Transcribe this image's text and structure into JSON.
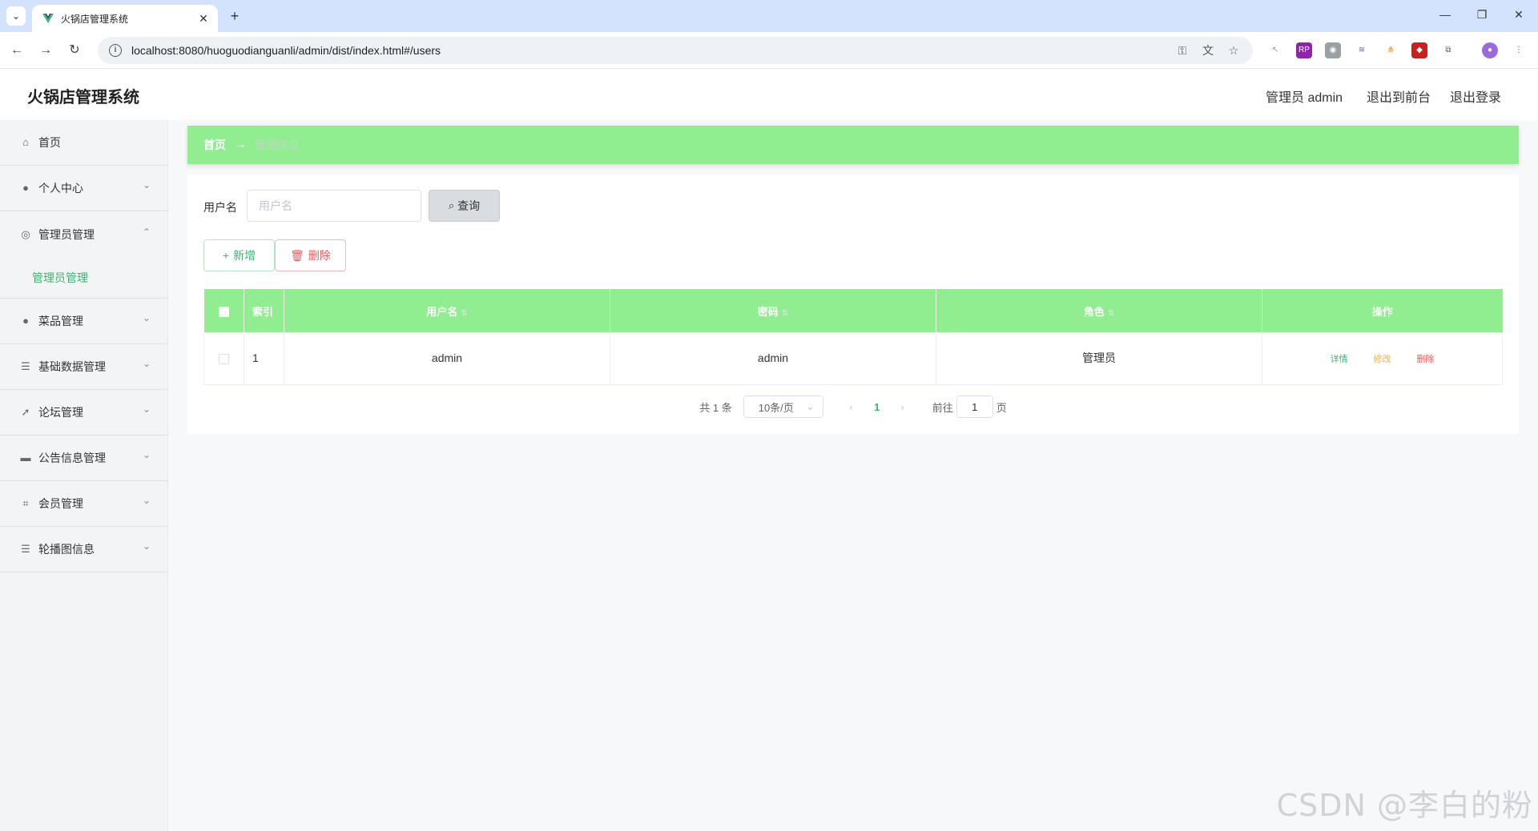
{
  "browser": {
    "tab_title": "火锅店管理系统",
    "url": "localhost:8080/huoguodianguanli/admin/dist/index.html#/users"
  },
  "header": {
    "app_title": "火锅店管理系统",
    "user_label": "管理员 admin",
    "front_link": "退出到前台",
    "logout_link": "退出登录"
  },
  "sidebar": {
    "items": [
      {
        "label": "首页",
        "icon": "home-icon"
      },
      {
        "label": "个人中心",
        "icon": "user-icon"
      },
      {
        "label": "管理员管理",
        "icon": "compass-icon"
      },
      {
        "label": "菜品管理",
        "icon": "user-icon"
      },
      {
        "label": "基础数据管理",
        "icon": "list-icon"
      },
      {
        "label": "论坛管理",
        "icon": "send-icon"
      },
      {
        "label": "公告信息管理",
        "icon": "briefcase-icon"
      },
      {
        "label": "会员管理",
        "icon": "crop-icon"
      },
      {
        "label": "轮播图信息",
        "icon": "list-icon"
      }
    ],
    "sub_item": "管理员管理"
  },
  "breadcrumb": {
    "home": "首页",
    "sep": "→",
    "current": "管理信息"
  },
  "search": {
    "label": "用户名",
    "placeholder": "用户名",
    "button": "查询"
  },
  "actions": {
    "add": "新增",
    "delete": "删除"
  },
  "table": {
    "headers": [
      "索引",
      "用户名",
      "密码",
      "角色",
      "操作"
    ],
    "rows": [
      {
        "index": "1",
        "username": "admin",
        "password": "admin",
        "role": "管理员"
      }
    ],
    "ops": {
      "detail": "详情",
      "edit": "修改",
      "delete": "删除"
    }
  },
  "pagination": {
    "total": "共 1 条",
    "page_size": "10条/页",
    "current_page": "1",
    "goto_label": "前往",
    "goto_value": "1",
    "page_suffix": "页"
  },
  "watermark": "CSDN @李白的粉",
  "colors": {
    "accent_green": "#90ee90",
    "link_green": "#3cb371",
    "warn_orange": "#f0b050",
    "danger_red": "#e55a5a"
  }
}
